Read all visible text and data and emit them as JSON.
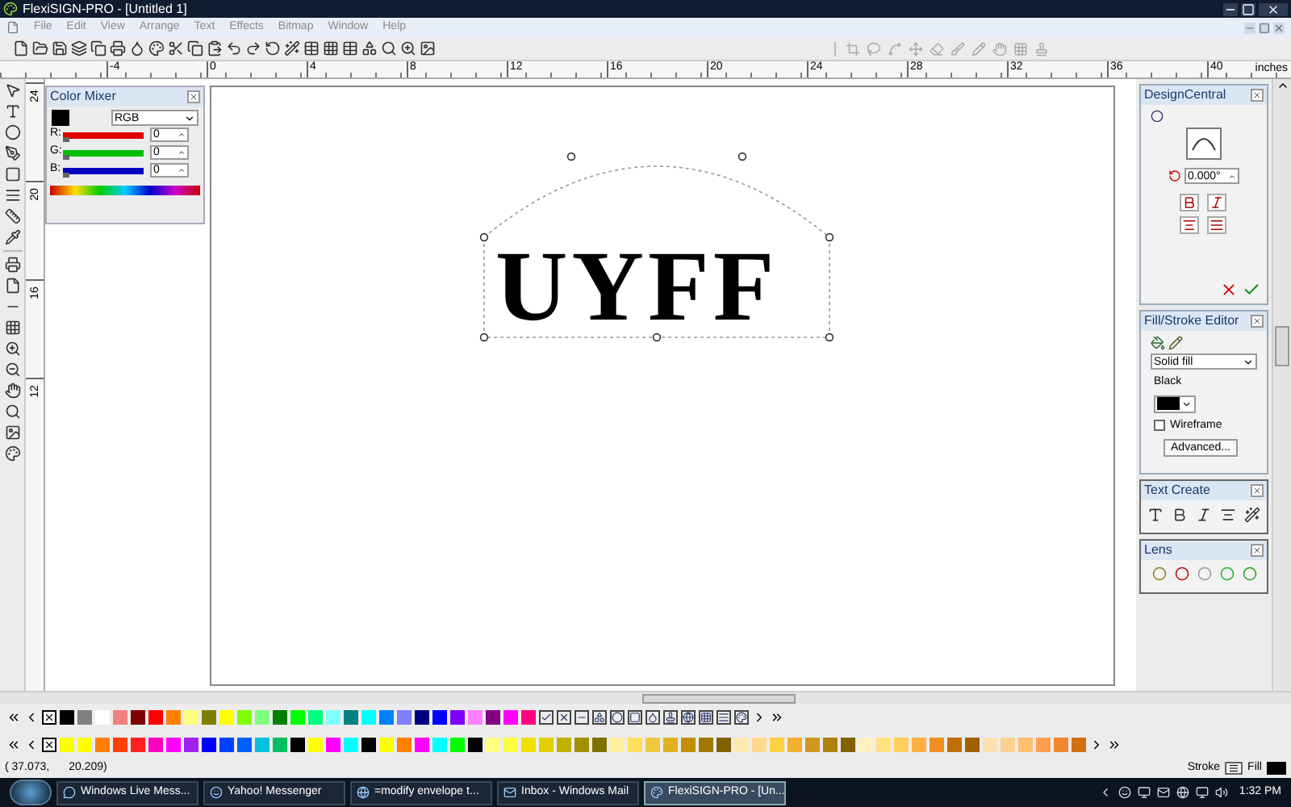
{
  "window": {
    "title": "FlexiSIGN-PRO - [Untitled 1]"
  },
  "menu": [
    "File",
    "Edit",
    "View",
    "Arrange",
    "Text",
    "Effects",
    "Bitmap",
    "Window",
    "Help"
  ],
  "ruler": {
    "labels": [
      "-4",
      "0",
      "4",
      "8",
      "12",
      "16",
      "20",
      "24",
      "28",
      "32",
      "36",
      "40"
    ],
    "unit": "inches"
  },
  "vertical_ruler": {
    "labels": [
      "24",
      "20",
      "16",
      "12"
    ]
  },
  "color_mixer": {
    "title": "Color Mixer",
    "mode": "RGB",
    "channels": [
      {
        "name": "R:",
        "value": "0",
        "level": 0,
        "color": "#e00000"
      },
      {
        "name": "G:",
        "value": "0",
        "level": 0,
        "color": "#00c000"
      },
      {
        "name": "B:",
        "value": "0",
        "level": 0,
        "color": "#0000c0"
      }
    ]
  },
  "canvas": {
    "text": "UYFF"
  },
  "design_central": {
    "title": "DesignCentral",
    "angle": "0.000°"
  },
  "fill_stroke_editor": {
    "title": "Fill/Stroke Editor",
    "fill_type": "Solid fill",
    "color_name": "Black",
    "wireframe": {
      "label": "Wireframe",
      "checked": false
    },
    "advanced_button": "Advanced..."
  },
  "text_create": {
    "title": "Text Create"
  },
  "lens": {
    "title": "Lens"
  },
  "palette_rows": [
    {
      "swatches": [
        {
          "color": "#000000"
        },
        {
          "color": "#808080"
        },
        {
          "color": "#ffffff"
        },
        {
          "color": "#f08080"
        },
        {
          "color": "#800000"
        },
        {
          "color": "#ff0000"
        },
        {
          "color": "#ff8000"
        },
        {
          "color": "#ffff80"
        },
        {
          "color": "#808000"
        },
        {
          "color": "#ffff00"
        },
        {
          "color": "#80ff00"
        },
        {
          "color": "#80ff80"
        },
        {
          "color": "#008000"
        },
        {
          "color": "#00ff00"
        },
        {
          "color": "#00ff80"
        },
        {
          "color": "#80ffff"
        },
        {
          "color": "#008080"
        },
        {
          "color": "#00ffff"
        },
        {
          "color": "#0080ff"
        },
        {
          "color": "#8080ff"
        },
        {
          "color": "#000080"
        },
        {
          "color": "#0000ff"
        },
        {
          "color": "#8000ff"
        },
        {
          "color": "#ff80ff"
        },
        {
          "color": "#800080"
        },
        {
          "color": "#ff00ff"
        },
        {
          "color": "#ff0080"
        }
      ]
    },
    {
      "swatches": [
        {
          "color": "#ffff00"
        },
        {
          "color": "#ffff00"
        },
        {
          "color": "#ff8000"
        },
        {
          "color": "#ff4000"
        },
        {
          "color": "#ff2020"
        },
        {
          "color": "#ff00c0"
        },
        {
          "color": "#ff00ff"
        },
        {
          "color": "#a020f0"
        },
        {
          "color": "#0000ff"
        },
        {
          "color": "#0040ff"
        },
        {
          "color": "#0060ff"
        },
        {
          "color": "#00c0e0"
        },
        {
          "color": "#00c060"
        },
        {
          "color": "#000000"
        },
        {
          "color": "#ffff00"
        },
        {
          "color": "#ff00ff"
        },
        {
          "color": "#00ffff"
        },
        {
          "color": "#000000"
        },
        {
          "color": "#ffff00"
        },
        {
          "color": "#ff8000"
        },
        {
          "color": "#ff00ff"
        },
        {
          "color": "#00ffff"
        },
        {
          "color": "#00ff00"
        },
        {
          "color": "#000000"
        },
        {
          "color": "#ffff80"
        },
        {
          "color": "#ffff40"
        },
        {
          "color": "#f0e000"
        },
        {
          "color": "#e0d000"
        },
        {
          "color": "#c0b000"
        },
        {
          "color": "#a09000"
        },
        {
          "color": "#807000"
        },
        {
          "color": "#fff0a0"
        },
        {
          "color": "#ffe060"
        },
        {
          "color": "#f0c840"
        },
        {
          "color": "#e0b020"
        },
        {
          "color": "#c09000"
        },
        {
          "color": "#a07800"
        },
        {
          "color": "#806000"
        },
        {
          "color": "#ffe8b0"
        },
        {
          "color": "#ffd890"
        },
        {
          "color": "#ffd040"
        },
        {
          "color": "#f0b030"
        },
        {
          "color": "#d09820"
        },
        {
          "color": "#b08010"
        },
        {
          "color": "#806000"
        },
        {
          "color": "#fff0c0"
        },
        {
          "color": "#ffe080"
        },
        {
          "color": "#ffd060"
        },
        {
          "color": "#ffb040"
        },
        {
          "color": "#f09020"
        },
        {
          "color": "#c07000"
        },
        {
          "color": "#a06000"
        },
        {
          "color": "#ffe0b0"
        },
        {
          "color": "#ffd090"
        },
        {
          "color": "#ffc070"
        },
        {
          "color": "#ffa050"
        },
        {
          "color": "#f08830"
        },
        {
          "color": "#d07010"
        }
      ]
    }
  ],
  "status_bar": {
    "coordinate_x": "( 37.073,",
    "coordinate_y": "20.209)",
    "stroke_label": "Stroke",
    "fill_label": "Fill"
  },
  "taskbar": {
    "items": [
      {
        "label": "Windows Live Mess...",
        "selected": false
      },
      {
        "label": "Yahoo! Messenger",
        "selected": false
      },
      {
        "label": "=modify envelope t...",
        "selected": false
      },
      {
        "label": "Inbox - Windows Mail",
        "selected": false
      },
      {
        "label": "FlexiSIGN-PRO - [Un...",
        "selected": true
      }
    ],
    "clock": "1:32 PM"
  }
}
